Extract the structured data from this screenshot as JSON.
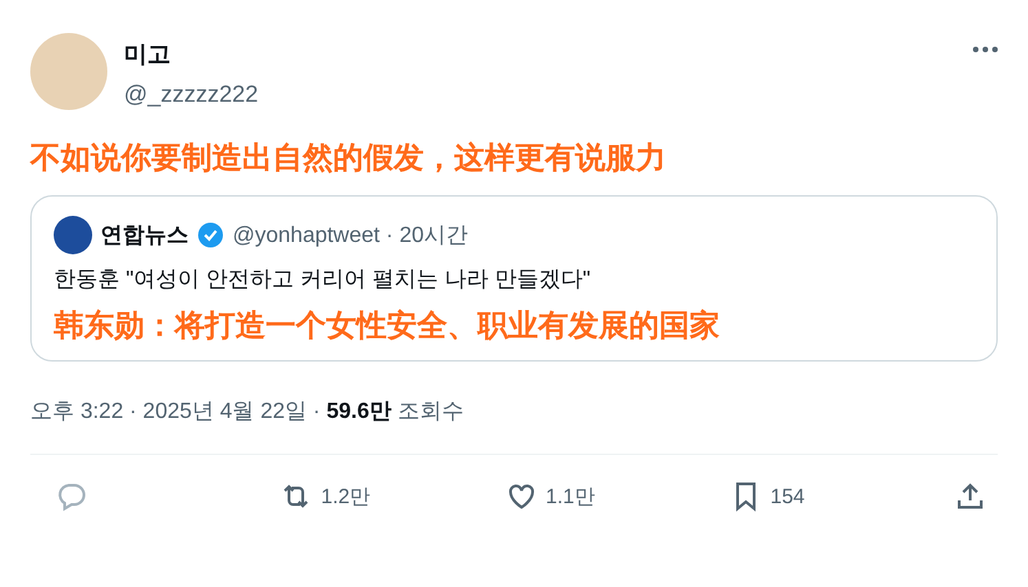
{
  "author": {
    "name": "미고",
    "handle": "@_zzzzz222"
  },
  "caption": "不如说你要制造出自然的假发，这样更有说服力",
  "quote": {
    "name": "연합뉴스",
    "verified": true,
    "handle": "@yonhaptweet · 20시간",
    "text": "한동훈 \"여성이 안전하고 커리어 펼치는 나라 만들겠다\"",
    "caption": "韩东勋：将打造一个女性安全、职业有发展的国家"
  },
  "meta": {
    "time": "오후 3:22 · 2025년 4월 22일 · ",
    "views": "59.6만",
    "views_label": "조회수"
  },
  "actions": [
    {
      "kind": "reply"
    },
    {
      "kind": "retweet",
      "count": "1.2만"
    },
    {
      "kind": "like",
      "count": "1.1만"
    },
    {
      "kind": "bookmark",
      "count": "154"
    },
    {
      "kind": "share"
    }
  ]
}
